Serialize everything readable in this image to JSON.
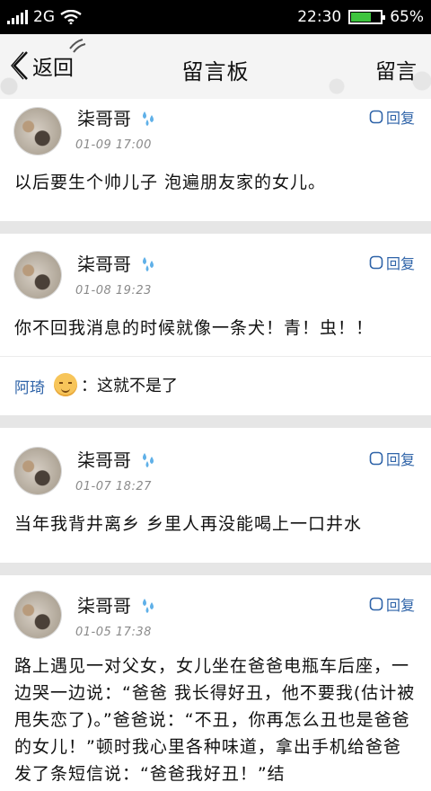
{
  "status": {
    "carrier": "2G",
    "time": "22:30",
    "battery": "65%",
    "battery_level": 0.65
  },
  "header": {
    "back_label": "返回",
    "title": "留言板",
    "action_label": "留言"
  },
  "messages": [
    {
      "name": "柒哥哥",
      "time": "01-09 17:00",
      "reply_label": "回复",
      "content": "以后要生个帅儿子 泡遍朋友家的女儿。"
    },
    {
      "name": "柒哥哥",
      "time": "01-08 19:23",
      "reply_label": "回复",
      "content": "你不回我消息的时候就像一条犬！青！虫！！",
      "sub_reply": {
        "who": "阿琦",
        "text": "：这就不是了"
      }
    },
    {
      "name": "柒哥哥",
      "time": "01-07 18:27",
      "reply_label": "回复",
      "content": "当年我背井离乡 乡里人再没能喝上一口井水"
    },
    {
      "name": "柒哥哥",
      "time": "01-05 17:38",
      "reply_label": "回复",
      "content": "路上遇见一对父女，女儿坐在爸爸电瓶车后座，一边哭一边说：“爸爸 我长得好丑，他不要我(估计被甩失恋了)。”爸爸说：“不丑，你再怎么丑也是爸爸的女儿！”顿时我心里各种味道，拿出手机给爸爸发了条短信说：“爸爸我好丑！”结"
    }
  ]
}
